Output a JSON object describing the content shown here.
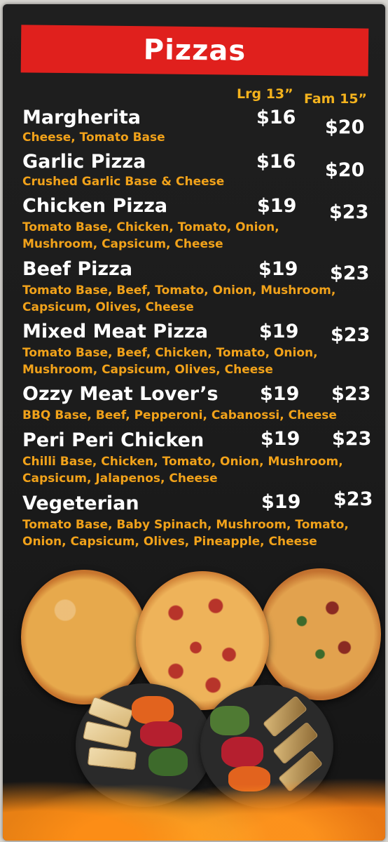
{
  "menu": {
    "title": "Pizzas",
    "sizes": {
      "large": "Lrg 13”",
      "family": "Fam 15”"
    },
    "items": [
      {
        "name": "Margherita",
        "desc": "Cheese, Tomato Base",
        "large": "$16",
        "family": "$20"
      },
      {
        "name": "Garlic Pizza",
        "desc": "Crushed Garlic Base & Cheese",
        "large": "$16",
        "family": "$20"
      },
      {
        "name": "Chicken Pizza",
        "desc": "Tomato Base, Chicken, Tomato, Onion,\nMushroom, Capsicum, Cheese",
        "large": "$19",
        "family": "$23"
      },
      {
        "name": "Beef Pizza",
        "desc": "Tomato Base, Beef, Tomato, Onion, Mushroom,\nCapsicum, Olives, Cheese",
        "large": "$19",
        "family": "$23"
      },
      {
        "name": "Mixed Meat Pizza",
        "desc": "Tomato Base, Beef, Chicken, Tomato, Onion,\nMushroom, Capsicum, Olives, Cheese",
        "large": "$19",
        "family": "$23"
      },
      {
        "name": "Ozzy Meat Lover’s",
        "desc": "BBQ Base, Beef, Pepperoni, Cabanossi, Cheese",
        "large": "$19",
        "family": "$23"
      },
      {
        "name": "Peri Peri Chicken",
        "desc": "Chilli Base, Chicken, Tomato, Onion, Mushroom,\nCapsicum, Jalapenos, Cheese",
        "large": "$19",
        "family": "$23"
      },
      {
        "name": "Vegeterian",
        "desc": "Tomato Base, Baby Spinach, Mushroom, Tomato,\nOnion, Capsicum, Olives, Pineapple, Cheese",
        "large": "$19",
        "family": "$23"
      }
    ]
  },
  "colors": {
    "banner": "#e0201d",
    "accent": "#f1a21a",
    "background": "#1f1f1f",
    "text": "#ffffff"
  }
}
